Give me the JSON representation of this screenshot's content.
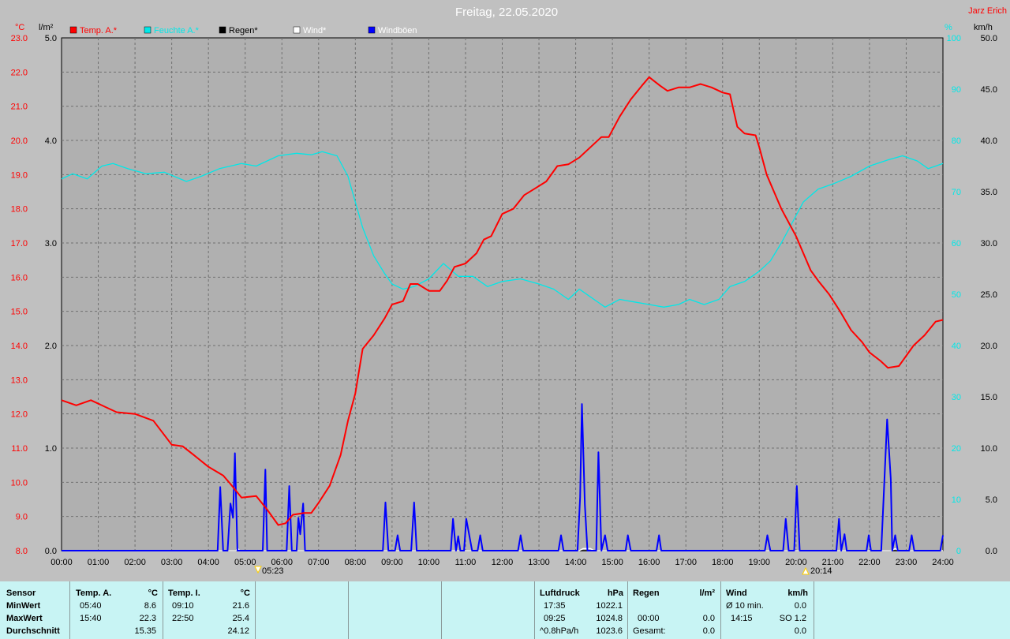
{
  "window": {
    "title": "Freitag, 22.05.2020",
    "author": "Jarz Erich"
  },
  "axes": {
    "left1_unit": "°C",
    "left2_unit": "l/m²",
    "right1_unit": "%",
    "right2_unit": "km/h",
    "temp_ticks": [
      "8.0",
      "9.0",
      "10.0",
      "11.0",
      "12.0",
      "13.0",
      "14.0",
      "15.0",
      "16.0",
      "17.0",
      "18.0",
      "19.0",
      "20.0",
      "21.0",
      "22.0",
      "23.0"
    ],
    "rain_ticks": [
      "0.0",
      "1.0",
      "2.0",
      "3.0",
      "4.0",
      "5.0"
    ],
    "hum_ticks": [
      "0",
      "10",
      "20",
      "30",
      "40",
      "50",
      "60",
      "70",
      "80",
      "90",
      "100"
    ],
    "wind_ticks": [
      "0.0",
      "5.0",
      "10.0",
      "15.0",
      "20.0",
      "25.0",
      "30.0",
      "35.0",
      "40.0",
      "45.0",
      "50.0"
    ],
    "time_ticks": [
      "00:00",
      "01:00",
      "02:00",
      "03:00",
      "04:00",
      "05:00",
      "06:00",
      "07:00",
      "08:00",
      "09:00",
      "10:00",
      "11:00",
      "12:00",
      "13:00",
      "14:00",
      "15:00",
      "16:00",
      "17:00",
      "18:00",
      "19:00",
      "20:00",
      "21:00",
      "22:00",
      "23:00",
      "24:00"
    ],
    "sunrise": "05:23",
    "sunset": "20:14"
  },
  "chart_data": {
    "type": "line",
    "title": "Freitag, 22.05.2020",
    "x_unit": "hours",
    "temp_range": [
      8,
      23
    ],
    "rain_range": [
      0,
      5
    ],
    "hum_range": [
      0,
      100
    ],
    "wind_range": [
      0,
      50
    ],
    "series": [
      {
        "name": "Temp. A.*",
        "color": "#ff0000",
        "axis": "temp",
        "points": [
          [
            0,
            12.4
          ],
          [
            0.4,
            12.25
          ],
          [
            0.8,
            12.4
          ],
          [
            1.2,
            12.2
          ],
          [
            1.5,
            12.05
          ],
          [
            2,
            12.0
          ],
          [
            2.5,
            11.8
          ],
          [
            3,
            11.1
          ],
          [
            3.3,
            11.05
          ],
          [
            3.6,
            10.8
          ],
          [
            4,
            10.45
          ],
          [
            4.4,
            10.2
          ],
          [
            4.6,
            9.95
          ],
          [
            4.9,
            9.55
          ],
          [
            5.3,
            9.6
          ],
          [
            5.6,
            9.2
          ],
          [
            5.9,
            8.75
          ],
          [
            6.1,
            8.8
          ],
          [
            6.3,
            9.05
          ],
          [
            6.6,
            9.1
          ],
          [
            6.8,
            9.1
          ],
          [
            7.0,
            9.4
          ],
          [
            7.3,
            9.9
          ],
          [
            7.6,
            10.8
          ],
          [
            7.8,
            11.8
          ],
          [
            8.0,
            12.6
          ],
          [
            8.2,
            13.9
          ],
          [
            8.5,
            14.3
          ],
          [
            8.8,
            14.8
          ],
          [
            9.0,
            15.2
          ],
          [
            9.3,
            15.3
          ],
          [
            9.5,
            15.8
          ],
          [
            9.7,
            15.8
          ],
          [
            10.0,
            15.6
          ],
          [
            10.3,
            15.6
          ],
          [
            10.5,
            15.9
          ],
          [
            10.7,
            16.3
          ],
          [
            11.0,
            16.4
          ],
          [
            11.3,
            16.7
          ],
          [
            11.5,
            17.1
          ],
          [
            11.7,
            17.2
          ],
          [
            12.0,
            17.85
          ],
          [
            12.3,
            18.0
          ],
          [
            12.6,
            18.4
          ],
          [
            12.9,
            18.6
          ],
          [
            13.2,
            18.8
          ],
          [
            13.5,
            19.25
          ],
          [
            13.8,
            19.3
          ],
          [
            14.1,
            19.5
          ],
          [
            14.4,
            19.8
          ],
          [
            14.7,
            20.1
          ],
          [
            14.9,
            20.1
          ],
          [
            15.2,
            20.7
          ],
          [
            15.5,
            21.2
          ],
          [
            15.8,
            21.6
          ],
          [
            16.0,
            21.85
          ],
          [
            16.3,
            21.6
          ],
          [
            16.5,
            21.45
          ],
          [
            16.8,
            21.55
          ],
          [
            17.1,
            21.55
          ],
          [
            17.4,
            21.65
          ],
          [
            17.7,
            21.55
          ],
          [
            18.0,
            21.4
          ],
          [
            18.2,
            21.35
          ],
          [
            18.4,
            20.4
          ],
          [
            18.6,
            20.2
          ],
          [
            18.9,
            20.15
          ],
          [
            19.0,
            19.8
          ],
          [
            19.2,
            19.0
          ],
          [
            19.4,
            18.5
          ],
          [
            19.6,
            18.0
          ],
          [
            19.8,
            17.6
          ],
          [
            20.0,
            17.2
          ],
          [
            20.2,
            16.7
          ],
          [
            20.4,
            16.2
          ],
          [
            20.6,
            15.9
          ],
          [
            20.9,
            15.5
          ],
          [
            21.2,
            15.0
          ],
          [
            21.5,
            14.45
          ],
          [
            21.8,
            14.1
          ],
          [
            22.0,
            13.8
          ],
          [
            22.3,
            13.55
          ],
          [
            22.5,
            13.35
          ],
          [
            22.8,
            13.4
          ],
          [
            23.0,
            13.7
          ],
          [
            23.2,
            14.0
          ],
          [
            23.5,
            14.3
          ],
          [
            23.8,
            14.7
          ],
          [
            24.0,
            14.75
          ]
        ]
      },
      {
        "name": "Feuchte A.*",
        "color": "#00e8e8",
        "axis": "hum",
        "points": [
          [
            0,
            72.5
          ],
          [
            0.3,
            73.5
          ],
          [
            0.7,
            72.5
          ],
          [
            1.1,
            75
          ],
          [
            1.4,
            75.5
          ],
          [
            1.8,
            74.5
          ],
          [
            2.3,
            73.5
          ],
          [
            2.8,
            73.8
          ],
          [
            3.4,
            72
          ],
          [
            3.8,
            73
          ],
          [
            4.3,
            74.5
          ],
          [
            4.9,
            75.5
          ],
          [
            5.3,
            75
          ],
          [
            5.9,
            77
          ],
          [
            6.4,
            77.5
          ],
          [
            6.8,
            77.2
          ],
          [
            7.1,
            77.8
          ],
          [
            7.5,
            77
          ],
          [
            7.8,
            73
          ],
          [
            8.0,
            68
          ],
          [
            8.2,
            63
          ],
          [
            8.5,
            57.5
          ],
          [
            8.8,
            54
          ],
          [
            9.0,
            52
          ],
          [
            9.3,
            51
          ],
          [
            9.6,
            51.5
          ],
          [
            10.0,
            53
          ],
          [
            10.4,
            56
          ],
          [
            10.8,
            53.5
          ],
          [
            11.2,
            53.5
          ],
          [
            11.6,
            51.5
          ],
          [
            12.0,
            52.5
          ],
          [
            12.5,
            53
          ],
          [
            13.0,
            52
          ],
          [
            13.4,
            51
          ],
          [
            13.8,
            49
          ],
          [
            14.1,
            51
          ],
          [
            14.4,
            49.5
          ],
          [
            14.8,
            47.5
          ],
          [
            15.2,
            49
          ],
          [
            15.6,
            48.5
          ],
          [
            16.0,
            48
          ],
          [
            16.4,
            47.5
          ],
          [
            16.8,
            48
          ],
          [
            17.1,
            49
          ],
          [
            17.5,
            48
          ],
          [
            17.9,
            49
          ],
          [
            18.2,
            51.5
          ],
          [
            18.6,
            52.5
          ],
          [
            19.0,
            54.5
          ],
          [
            19.3,
            56.5
          ],
          [
            19.6,
            60
          ],
          [
            19.9,
            64
          ],
          [
            20.2,
            68
          ],
          [
            20.6,
            70.5
          ],
          [
            21.0,
            71.5
          ],
          [
            21.5,
            73
          ],
          [
            22.0,
            75
          ],
          [
            22.5,
            76.2
          ],
          [
            22.9,
            77
          ],
          [
            23.3,
            76
          ],
          [
            23.6,
            74.5
          ],
          [
            24.0,
            75.5
          ]
        ]
      },
      {
        "name": "Regen*",
        "color": "#000000",
        "axis": "rain",
        "points": [
          [
            0,
            0
          ],
          [
            24,
            0
          ]
        ]
      },
      {
        "name": "Wind*",
        "color": "#ffffff",
        "axis": "wind",
        "points": [
          [
            0,
            0
          ],
          [
            4.75,
            0
          ],
          [
            4.8,
            0.2
          ],
          [
            4.85,
            0
          ],
          [
            14.1,
            0
          ],
          [
            14.2,
            0.2
          ],
          [
            14.4,
            0.2
          ],
          [
            14.5,
            0
          ],
          [
            22.6,
            0
          ],
          [
            22.7,
            0.2
          ],
          [
            22.8,
            0
          ],
          [
            24,
            0
          ]
        ]
      },
      {
        "name": "Windböen",
        "color": "#0000ff",
        "axis": "wind",
        "points": [
          [
            0,
            0
          ],
          [
            4.25,
            0
          ],
          [
            4.32,
            6.2
          ],
          [
            4.4,
            0
          ],
          [
            4.52,
            0
          ],
          [
            4.6,
            4.6
          ],
          [
            4.67,
            3.2
          ],
          [
            4.72,
            9.5
          ],
          [
            4.79,
            0
          ],
          [
            5.48,
            0
          ],
          [
            5.55,
            7.9
          ],
          [
            5.6,
            0
          ],
          [
            6.13,
            0
          ],
          [
            6.2,
            6.3
          ],
          [
            6.27,
            0
          ],
          [
            6.4,
            0
          ],
          [
            6.45,
            3.2
          ],
          [
            6.5,
            1.6
          ],
          [
            6.58,
            4.6
          ],
          [
            6.63,
            0
          ],
          [
            8.75,
            0
          ],
          [
            8.82,
            4.7
          ],
          [
            8.9,
            0
          ],
          [
            9.08,
            0
          ],
          [
            9.15,
            1.5
          ],
          [
            9.22,
            0
          ],
          [
            9.52,
            0
          ],
          [
            9.6,
            4.7
          ],
          [
            9.67,
            0
          ],
          [
            10.6,
            0
          ],
          [
            10.66,
            3.1
          ],
          [
            10.74,
            0
          ],
          [
            10.8,
            1.4
          ],
          [
            10.86,
            0
          ],
          [
            10.96,
            0
          ],
          [
            11.02,
            3.1
          ],
          [
            11.18,
            0
          ],
          [
            11.33,
            0
          ],
          [
            11.4,
            1.5
          ],
          [
            11.47,
            0
          ],
          [
            12.43,
            0
          ],
          [
            12.5,
            1.5
          ],
          [
            12.57,
            0
          ],
          [
            13.53,
            0
          ],
          [
            13.6,
            1.5
          ],
          [
            13.67,
            0
          ],
          [
            14.05,
            0
          ],
          [
            14.12,
            5.2
          ],
          [
            14.17,
            14.3
          ],
          [
            14.25,
            4.5
          ],
          [
            14.32,
            0
          ],
          [
            14.56,
            0
          ],
          [
            14.62,
            9.6
          ],
          [
            14.7,
            0
          ],
          [
            14.8,
            1.5
          ],
          [
            14.87,
            0
          ],
          [
            15.36,
            0
          ],
          [
            15.42,
            1.5
          ],
          [
            15.5,
            0
          ],
          [
            16.2,
            0
          ],
          [
            16.27,
            1.5
          ],
          [
            16.33,
            0
          ],
          [
            19.15,
            0
          ],
          [
            19.22,
            1.5
          ],
          [
            19.3,
            0
          ],
          [
            19.65,
            0
          ],
          [
            19.72,
            3.1
          ],
          [
            19.8,
            0
          ],
          [
            19.95,
            0
          ],
          [
            20.02,
            6.3
          ],
          [
            20.1,
            0
          ],
          [
            21.1,
            0
          ],
          [
            21.17,
            3.1
          ],
          [
            21.23,
            0
          ],
          [
            21.32,
            1.6
          ],
          [
            21.38,
            0
          ],
          [
            21.92,
            0
          ],
          [
            21.98,
            1.5
          ],
          [
            22.04,
            0
          ],
          [
            22.32,
            0
          ],
          [
            22.4,
            6.3
          ],
          [
            22.48,
            12.8
          ],
          [
            22.58,
            7.0
          ],
          [
            22.62,
            0
          ],
          [
            22.7,
            1.5
          ],
          [
            22.77,
            0
          ],
          [
            23.08,
            0
          ],
          [
            23.15,
            1.5
          ],
          [
            23.22,
            0
          ],
          [
            23.93,
            0
          ],
          [
            24,
            1.5
          ]
        ]
      }
    ]
  },
  "stats": {
    "sensor_h": "Sensor",
    "min_label": "MinWert",
    "max_label": "MaxWert",
    "avg_label": "Durchschnitt",
    "temp_a_h": "Temp. A.",
    "temp_a_unit": "°C",
    "temp_a_min_time": "05:40",
    "temp_a_min": "8.6",
    "temp_a_max_time": "15:40",
    "temp_a_max": "22.3",
    "temp_a_avg": "15.35",
    "temp_i_h": "Temp. I.",
    "temp_i_unit": "°C",
    "temp_i_min_time": "09:10",
    "temp_i_min": "21.6",
    "temp_i_max_time": "22:50",
    "temp_i_max": "25.4",
    "temp_i_avg": "24.12",
    "press_h": "Luftdruck",
    "press_unit": "hPa",
    "press_min_time": "17:35",
    "press_min": "1022.1",
    "press_max_time": "09:25",
    "press_max": "1024.8",
    "press_trend": "^0.8hPa/h",
    "press_avg": "1023.6",
    "rain_h": "Regen",
    "rain_unit": "l/m²",
    "rain_max_time": "00:00",
    "rain_max": "0.0",
    "rain_total_label": "Gesamt:",
    "rain_total": "0.0",
    "wind_h": "Wind",
    "wind_unit": "km/h",
    "wind_avg10_label": "Ø 10 min.",
    "wind_avg10": "0.0",
    "wind_max_time": "14:15",
    "wind_max_dir": "SO 1.2",
    "wind_total": "0.0"
  }
}
